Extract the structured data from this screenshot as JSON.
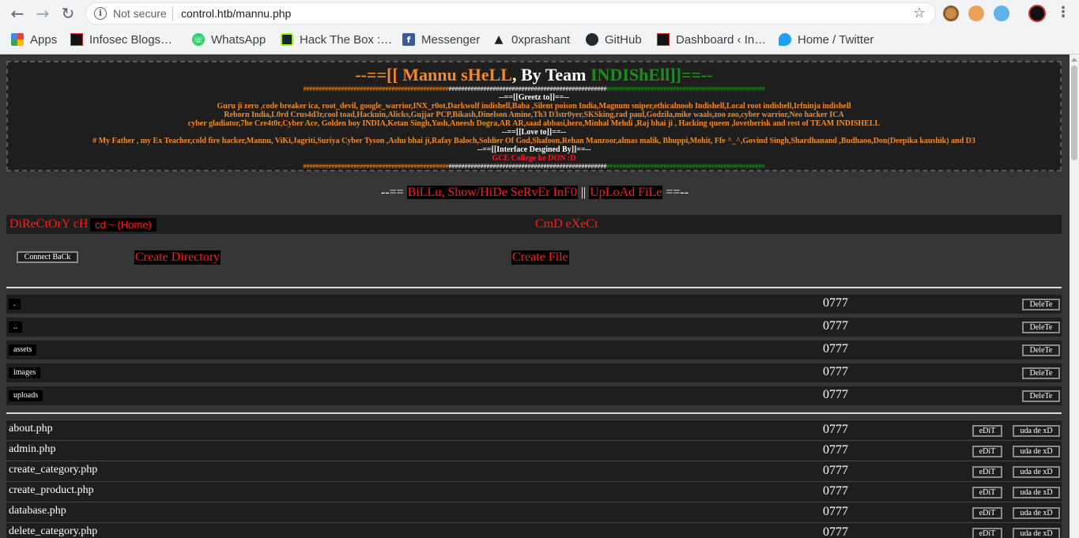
{
  "browser": {
    "security_label": "Not secure",
    "url": "control.htb/mannu.php",
    "bookmarks": [
      {
        "label": "Apps",
        "icon": "apps-grid-icon"
      },
      {
        "label": "Infosec Blogs…",
        "icon": "infosec-icon"
      },
      {
        "label": "WhatsApp",
        "icon": "whatsapp-icon"
      },
      {
        "label": "Hack The Box :…",
        "icon": "hackthebox-icon"
      },
      {
        "label": "Messenger",
        "icon": "facebook-icon"
      },
      {
        "label": "0xprashant",
        "icon": "linux-icon"
      },
      {
        "label": "GitHub",
        "icon": "github-icon"
      },
      {
        "label": "Dashboard ‹ In…",
        "icon": "dashboard-icon"
      },
      {
        "label": "Home / Twitter",
        "icon": "twitter-icon"
      }
    ]
  },
  "banner": {
    "title_prefix": "--==[[ Mannu sHeLL",
    "title_mid": ", By Team ",
    "title_team": "INDIShEll]]==--",
    "hash_orange": "##############################################",
    "hash_white": "##################################################",
    "hash_green": "##################################################",
    "greetz_heading": "--==[[Greetz to]]==--",
    "greetz_line1": "Guru ji zero ,code breaker ica, root_devil, google_warrior,INX_r0ot,Darkwolf indishell,Baba ,Silent poison India,Magnum sniper,ethicalnoob Indishell,Local root indishell,Irfninja indishell",
    "greetz_line2": "Reborn India,L0rd Crus4d3r,cool toad,Hackuin,Alicks,Gujjar PCP,Bikash,Dinelson Amine,Th3 D3str0yer,SKSking,rad paul,Godzila,mike waals,zoo zoo,cyber warrior,Neo hacker ICA",
    "greetz_line3": "cyber gladiator,7he Cre4t0r,Cyber Ace, Golden boy INDIA,Ketan Singh,Yash,Aneesh Dogra,AR AR,saad abbasi,hero,Minhal Mehdi ,Raj bhai ji , Hacking queen ,lovetherisk and rest of TEAM INDISHELL",
    "love_heading": "--==[[Love to]]==--",
    "love_line": "# My Father , my Ex Teacher,cold fire hacker,Mannu, ViKi,Jagriti,Suriya Cyber Tyson ,Ashu bhai ji,Rafay Baloch,Soldier Of God,Shafoon,Rehan Manzoor,almas malik, Bhuppi,Mohit, Ffe ^_^,Govind Singh,Shardhanand ,Budhaoo,Don(Deepika kaushik) and D3",
    "interface_heading": "--==[[Interface Desgined By]]==--",
    "interface_credit": "GCE College ke DON :D"
  },
  "links": {
    "prefix": "--== ",
    "show_hide": "BiLLu, Show/HiDe SeRvEr InF0",
    "separator": " || ",
    "upload": "UpLoAd FiLe",
    "suffix": " ==--"
  },
  "directory_bar": {
    "label": "DiReCtOrY cH",
    "cd_home": "cd ~ (Home)",
    "cmd_label": "CmD eXeCt"
  },
  "actions": {
    "connect_back": "Connect BaCk",
    "create_directory": "Create Directory",
    "create_file": "Create File"
  },
  "directories": [
    {
      "name": ".",
      "perm": "0777",
      "delete": "DeleTe"
    },
    {
      "name": "..",
      "perm": "0777",
      "delete": "DeleTe"
    },
    {
      "name": "assets",
      "perm": "0777",
      "delete": "DeleTe"
    },
    {
      "name": "images",
      "perm": "0777",
      "delete": "DeleTe"
    },
    {
      "name": "uploads",
      "perm": "0777",
      "delete": "DeleTe"
    }
  ],
  "files": [
    {
      "name": "about.php",
      "perm": "0777",
      "edit": "eDiT",
      "delete": "uda de xD"
    },
    {
      "name": "admin.php",
      "perm": "0777",
      "edit": "eDiT",
      "delete": "uda de xD"
    },
    {
      "name": "create_category.php",
      "perm": "0777",
      "edit": "eDiT",
      "delete": "uda de xD"
    },
    {
      "name": "create_product.php",
      "perm": "0777",
      "edit": "eDiT",
      "delete": "uda de xD"
    },
    {
      "name": "database.php",
      "perm": "0777",
      "edit": "eDiT",
      "delete": "uda de xD"
    },
    {
      "name": "delete_category.php",
      "perm": "0777",
      "edit": "eDiT",
      "delete": "uda de xD"
    }
  ],
  "colors": {
    "accent_red": "#ff1a1a",
    "title_orange": "#f0892c",
    "team_green": "#1f8c1f",
    "page_bg": "#353535",
    "panel_bg": "#1e1e1e"
  }
}
